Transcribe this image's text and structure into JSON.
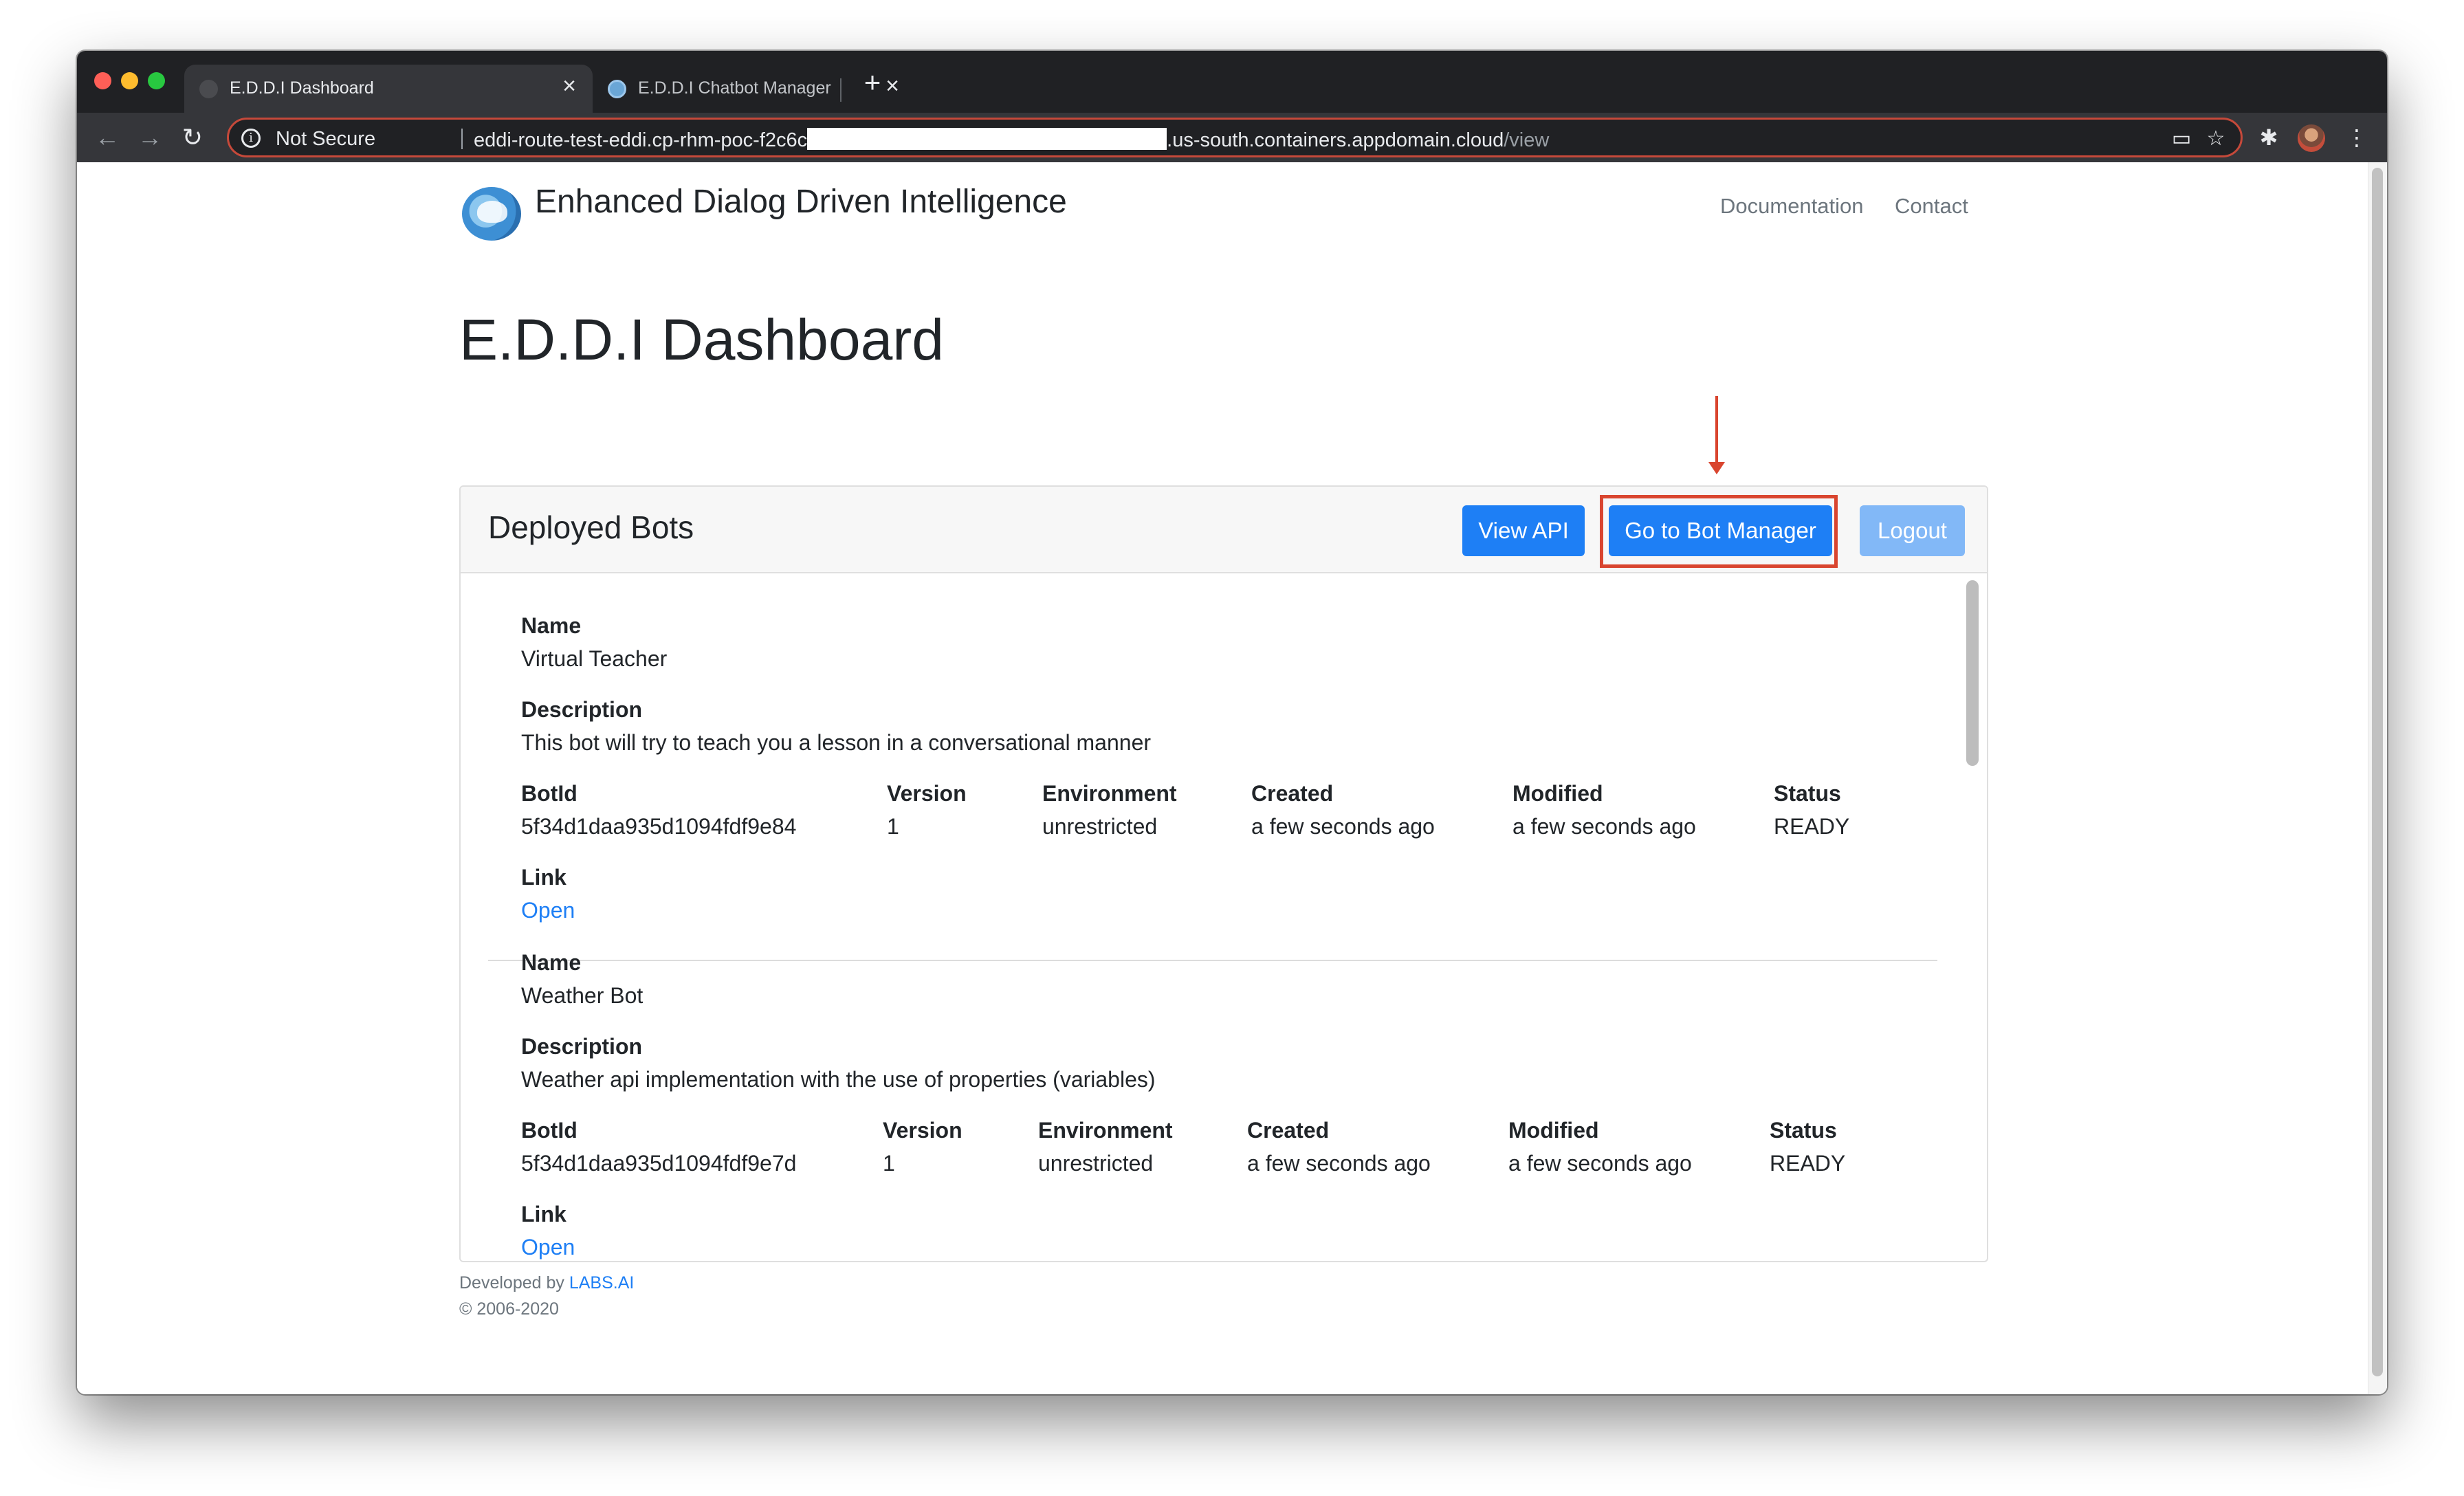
{
  "browser": {
    "tabs": [
      {
        "title": "E.D.D.I Dashboard",
        "active": true
      },
      {
        "title": "E.D.D.I Chatbot Manager",
        "active": false
      }
    ],
    "new_tab_symbol": "+",
    "close_symbol": "×",
    "security_label": "Not Secure",
    "url": {
      "host_start": "eddi-route-test-eddi.cp-rhm-poc-f2c6c",
      "host_end": ".us-south.containers.appdomain.cloud",
      "path": "/view"
    },
    "icons": {
      "back": "back-arrow-icon",
      "forward": "forward-arrow-icon",
      "reload": "reload-icon",
      "info": "info-icon",
      "cast": "cast-icon",
      "bookmark": "star-icon",
      "extensions": "puzzle-icon",
      "profile": "avatar",
      "menu": "kebab-menu-icon"
    }
  },
  "site": {
    "brand": "Enhanced Dialog Driven Intelligence",
    "nav": [
      "Documentation",
      "Contact"
    ]
  },
  "page": {
    "title": "E.D.D.I Dashboard"
  },
  "deployed": {
    "title": "Deployed Bots",
    "buttons": {
      "view_api": "View API",
      "bot_manager": "Go to Bot Manager",
      "logout": "Logout"
    },
    "labels": {
      "name": "Name",
      "description": "Description",
      "botid": "BotId",
      "version": "Version",
      "environment": "Environment",
      "created": "Created",
      "modified": "Modified",
      "status": "Status",
      "link": "Link"
    },
    "bots": [
      {
        "name": "Virtual Teacher",
        "description": "This bot will try to teach you a lesson in a conversational manner",
        "botid": "5f34d1daa935d1094fdf9e84",
        "version": "1",
        "environment": "unrestricted",
        "created": "a few seconds ago",
        "modified": "a few seconds ago",
        "status": "READY",
        "link": "Open"
      },
      {
        "name": "Weather Bot",
        "description": "Weather api implementation with the use of properties (variables)",
        "botid": "5f34d1daa935d1094fdf9e7d",
        "version": "1",
        "environment": "unrestricted",
        "created": "a few seconds ago",
        "modified": "a few seconds ago",
        "status": "READY",
        "link": "Open"
      }
    ]
  },
  "footer": {
    "developed_by": "Developed by ",
    "company": "LABS.AI",
    "copyright": "© 2006-2020"
  },
  "colors": {
    "primary_button": "#1e7ff5",
    "annotation": "#d9452f"
  }
}
